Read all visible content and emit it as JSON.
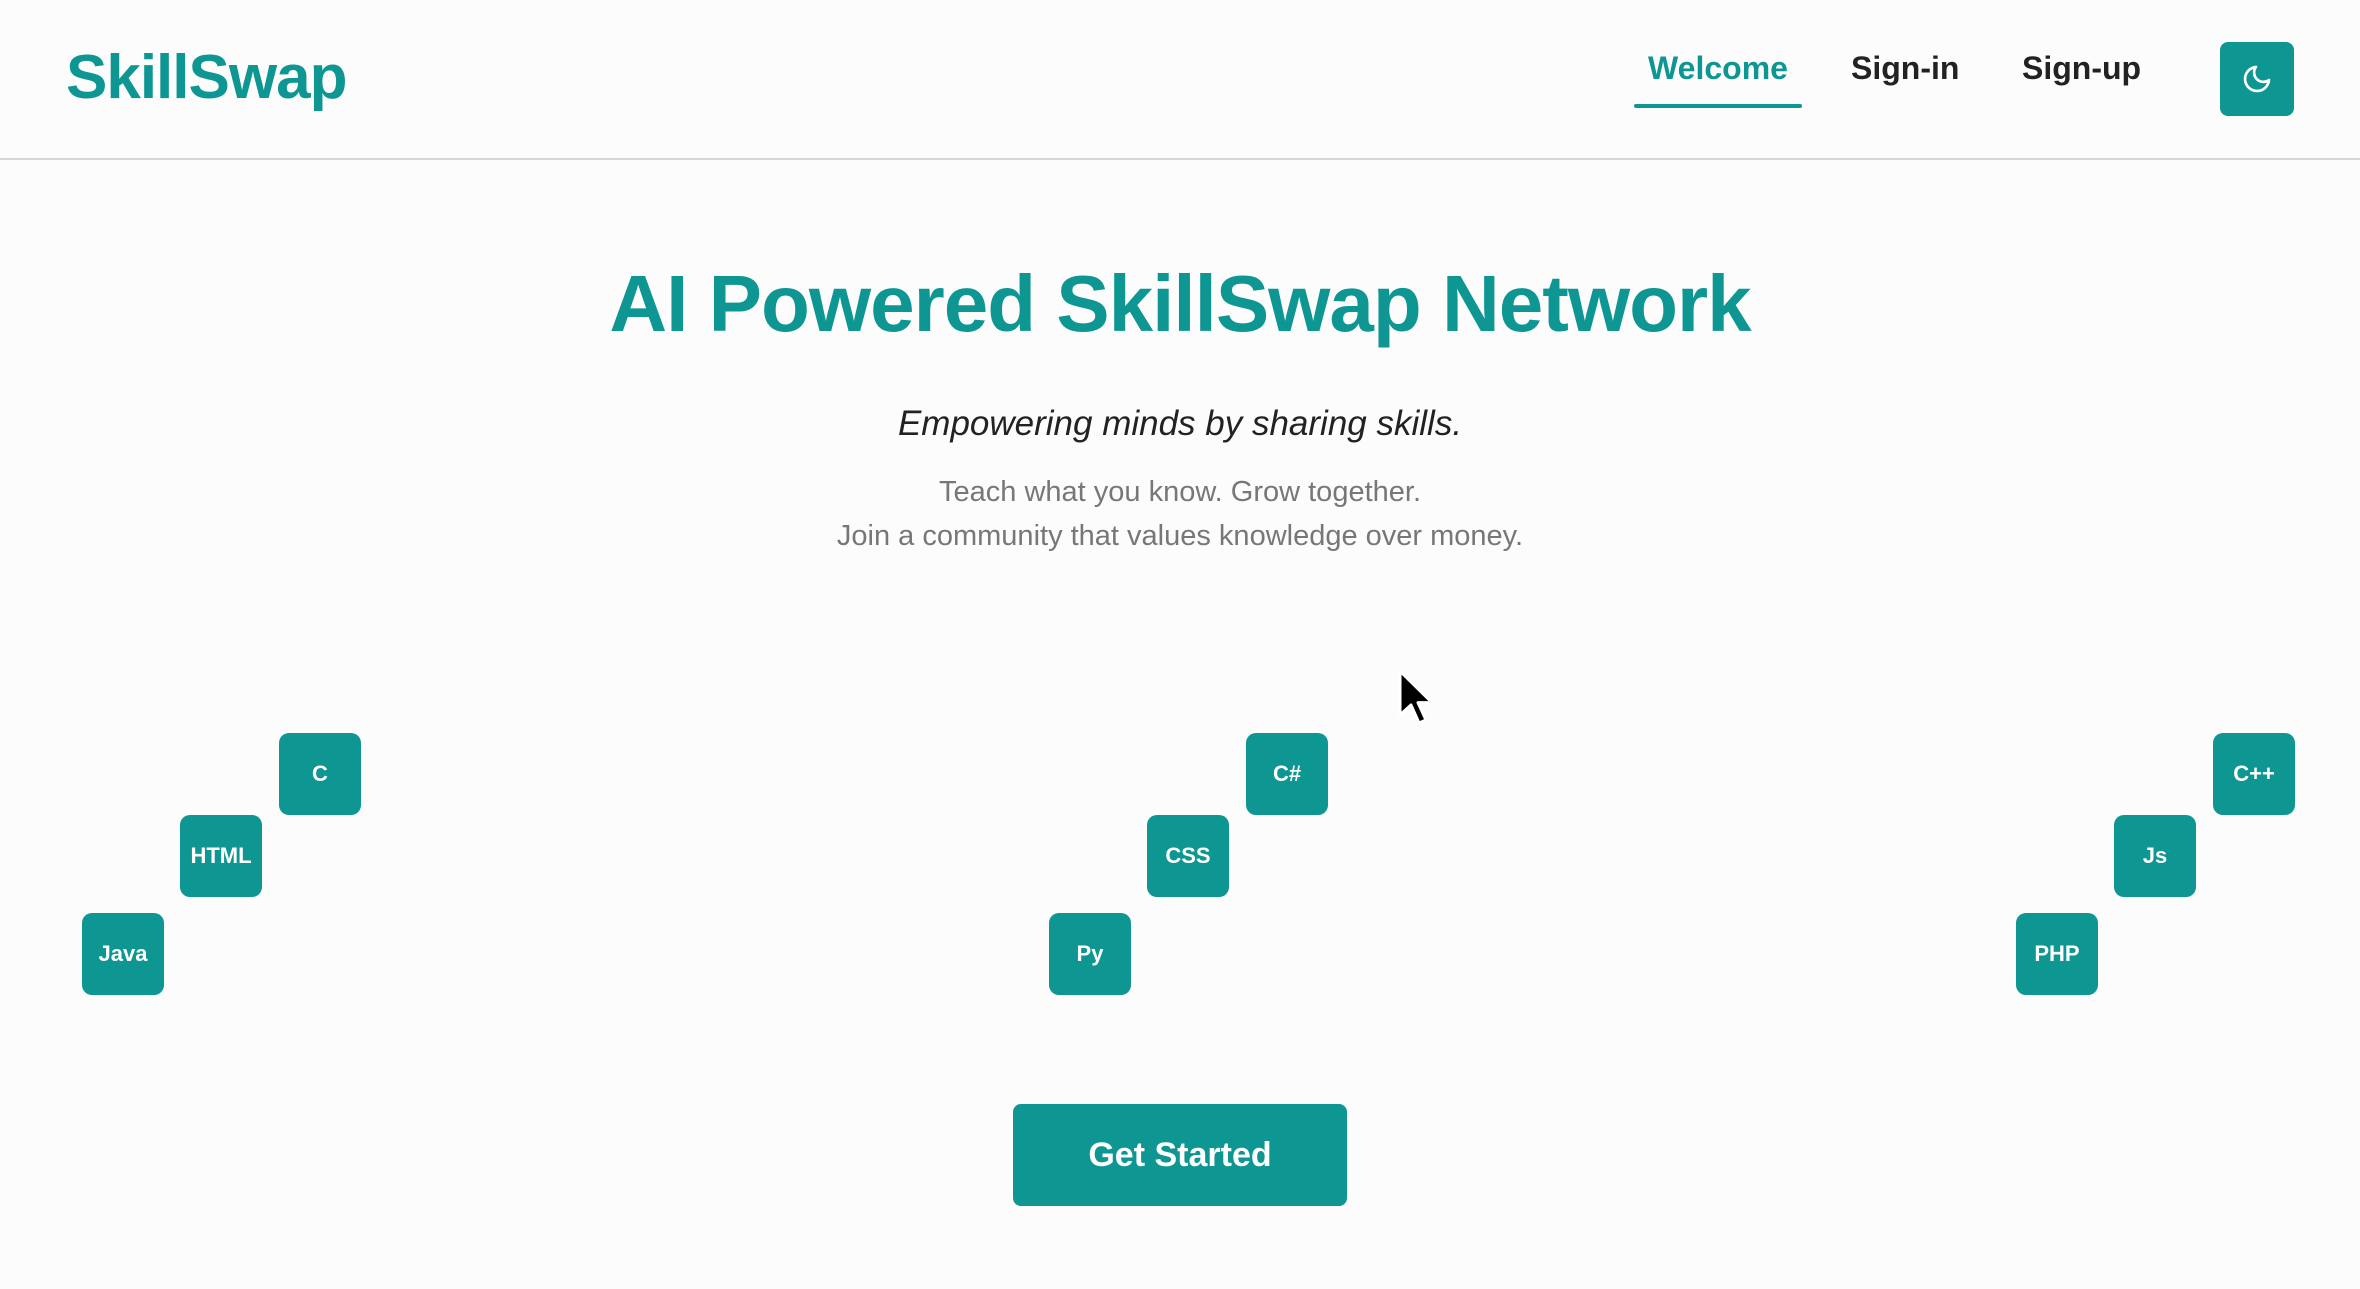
{
  "header": {
    "logo": "SkillSwap",
    "nav": {
      "welcome": "Welcome",
      "signin": "Sign-in",
      "signup": "Sign-up"
    },
    "theme_toggle_icon": "moon-icon",
    "active_tab": "Welcome"
  },
  "hero": {
    "title": "AI Powered SkillSwap Network",
    "tagline": "Empowering minds by sharing skills.",
    "subline1": "Teach what you know. Grow together.",
    "subline2": "Join a community that values knowledge over money."
  },
  "skills": {
    "group1": [
      "C",
      "HTML",
      "Java"
    ],
    "group2": [
      "C#",
      "CSS",
      "Py"
    ],
    "group3": [
      "C++",
      "Js",
      "PHP"
    ]
  },
  "cta": {
    "label": "Get Started"
  },
  "colors": {
    "accent": "#0e9693",
    "background": "#fcfcfd",
    "text": "#222222",
    "muted": "#777777"
  }
}
